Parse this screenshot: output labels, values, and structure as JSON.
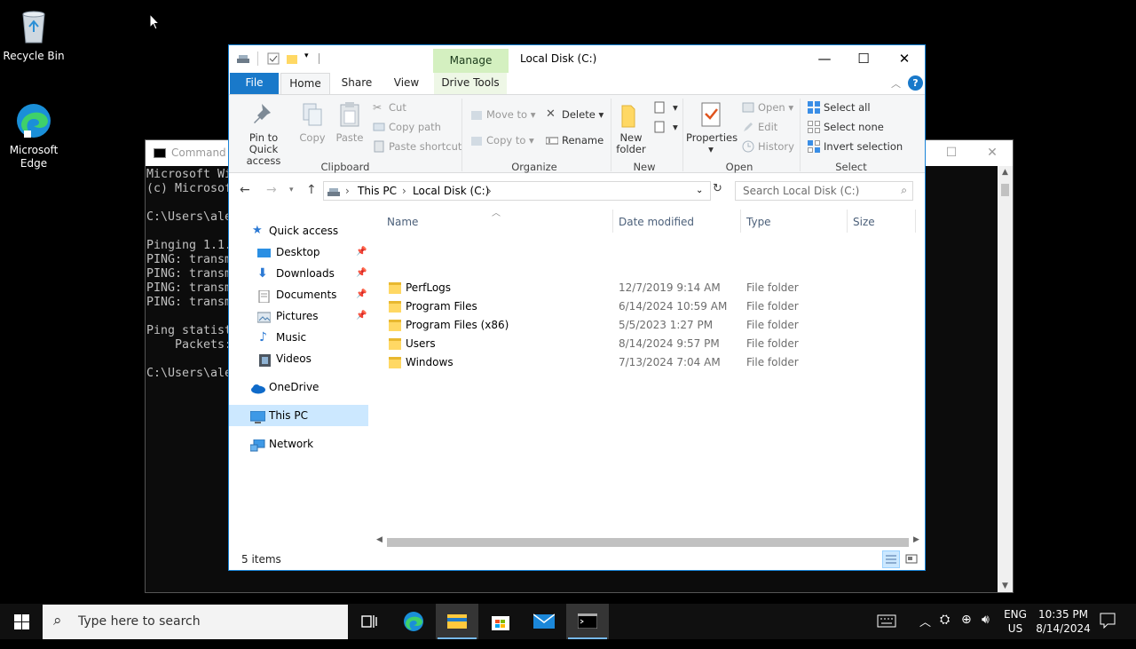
{
  "desktop": {
    "icons": [
      {
        "label": "Recycle Bin",
        "icon": "recycle-bin-icon"
      },
      {
        "label": "Microsoft\nEdge",
        "label_line1": "Microsoft",
        "label_line2": "Edge",
        "icon": "edge-icon"
      }
    ]
  },
  "cmd": {
    "title": "Command P",
    "lines": [
      "Microsoft Wi",
      "(c) Microsof",
      "",
      "C:\\Users\\ale",
      "",
      "Pinging 1.1.",
      "PING: transm",
      "PING: transm",
      "PING: transm",
      "PING: transm",
      "",
      "Ping statist",
      "    Packets:",
      "",
      "C:\\Users\\ale"
    ]
  },
  "explorer": {
    "title": "Local Disk (C:)",
    "context_tab": "Manage",
    "tabs": {
      "file": "File",
      "home": "Home",
      "share": "Share",
      "view": "View",
      "drive_tools": "Drive Tools"
    },
    "ribbon": {
      "clipboard": {
        "label": "Clipboard",
        "pin_line1": "Pin to Quick",
        "pin_line2": "access",
        "copy": "Copy",
        "paste": "Paste",
        "cut": "Cut",
        "copy_path": "Copy path",
        "paste_shortcut": "Paste shortcut"
      },
      "organize": {
        "label": "Organize",
        "move_to": "Move to",
        "copy_to": "Copy to",
        "delete": "Delete",
        "rename": "Rename"
      },
      "new": {
        "label": "New",
        "new_line1": "New",
        "new_line2": "folder"
      },
      "open": {
        "label": "Open",
        "properties": "Properties",
        "open": "Open",
        "edit": "Edit",
        "history": "History"
      },
      "select": {
        "label": "Select",
        "select_all": "Select all",
        "select_none": "Select none",
        "invert": "Invert selection"
      }
    },
    "address": {
      "crumb1": "This PC",
      "crumb2": "Local Disk (C:)",
      "search_placeholder": "Search Local Disk (C:)"
    },
    "nav": {
      "quick_access": "Quick access",
      "desktop": "Desktop",
      "downloads": "Downloads",
      "documents": "Documents",
      "pictures": "Pictures",
      "music": "Music",
      "videos": "Videos",
      "onedrive": "OneDrive",
      "this_pc": "This PC",
      "network": "Network"
    },
    "columns": {
      "name": "Name",
      "date": "Date modified",
      "type": "Type",
      "size": "Size"
    },
    "files": [
      {
        "name": "PerfLogs",
        "date": "12/7/2019 9:14 AM",
        "type": "File folder"
      },
      {
        "name": "Program Files",
        "date": "6/14/2024 10:59 AM",
        "type": "File folder"
      },
      {
        "name": "Program Files (x86)",
        "date": "5/5/2023 1:27 PM",
        "type": "File folder"
      },
      {
        "name": "Users",
        "date": "8/14/2024 9:57 PM",
        "type": "File folder"
      },
      {
        "name": "Windows",
        "date": "7/13/2024 7:04 AM",
        "type": "File folder"
      }
    ],
    "status": "5 items"
  },
  "taskbar": {
    "search_placeholder": "Type here to search",
    "lang_line1": "ENG",
    "lang_line2": "US",
    "time": "10:35 PM",
    "date": "8/14/2024"
  },
  "colors": {
    "accent": "#1979ca",
    "selection": "#cce8ff",
    "folder": "#ffd864",
    "manage_tab": "#d4f0c0"
  }
}
